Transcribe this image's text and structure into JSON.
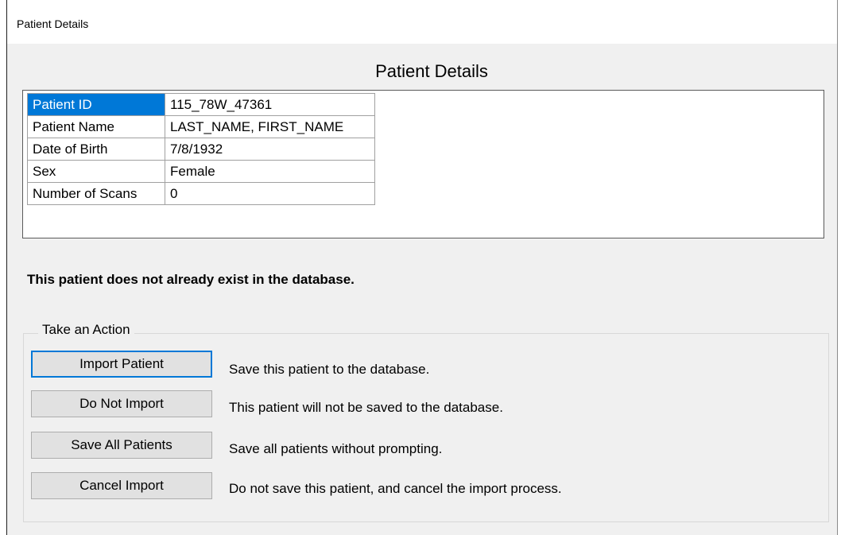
{
  "window": {
    "title": "Patient Details"
  },
  "details": {
    "heading": "Patient Details",
    "rows": [
      {
        "label": "Patient ID",
        "value": "115_78W_47361"
      },
      {
        "label": "Patient Name",
        "value": "LAST_NAME, FIRST_NAME"
      },
      {
        "label": "Date of Birth",
        "value": "7/8/1932"
      },
      {
        "label": "Sex",
        "value": "Female"
      },
      {
        "label": "Number of Scans",
        "value": "0"
      }
    ]
  },
  "notice": "This patient does not already exist in the database.",
  "actions": {
    "group_label": "Take an Action",
    "buttons": [
      {
        "label": "Import Patient",
        "description": "Save this patient to the database."
      },
      {
        "label": "Do Not Import",
        "description": "This patient will not be saved to the database."
      },
      {
        "label": "Save All Patients",
        "description": "Save all patients without prompting."
      },
      {
        "label": "Cancel Import",
        "description": "Do not save this patient, and cancel the import process."
      }
    ]
  },
  "colors": {
    "selection": "#0078d7",
    "window_bg": "#f0f0f0",
    "button_bg": "#e1e1e1"
  }
}
